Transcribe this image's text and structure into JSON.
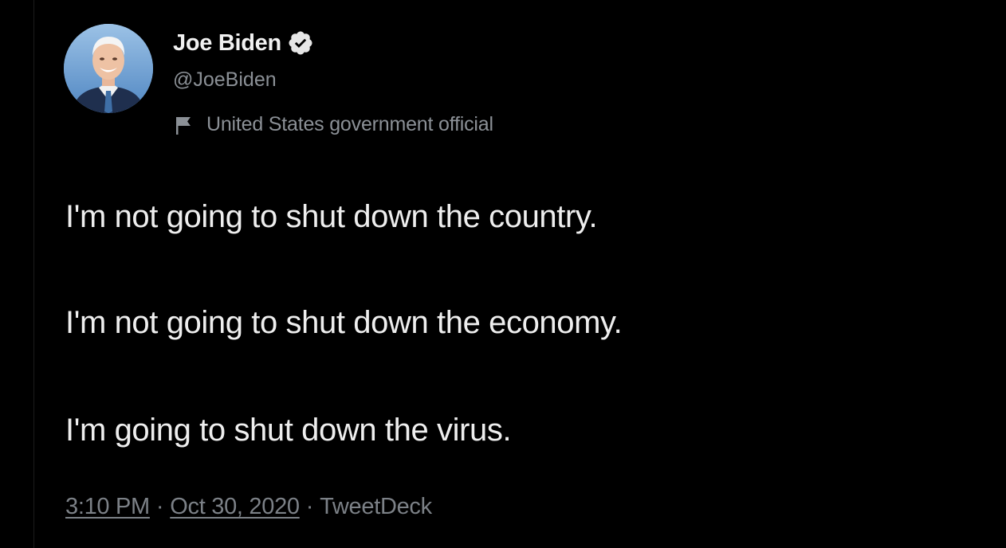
{
  "author": {
    "display_name": "Joe Biden",
    "handle": "@JoeBiden",
    "verified": true,
    "label": "United States government official"
  },
  "tweet": {
    "lines": [
      "I'm not going to shut down the country.",
      "I'm not going to shut down the economy.",
      "I'm going to shut down the virus."
    ]
  },
  "meta": {
    "time": "3:10 PM",
    "separator": "·",
    "date": "Oct 30, 2020",
    "source": "TweetDeck"
  },
  "colors": {
    "background": "#000000",
    "text": "#eeeeee",
    "secondary_text": "#8b9096",
    "verified_badge": "#e6e6e6"
  },
  "icons": {
    "verified": "verified-badge-icon",
    "label": "flag-icon"
  }
}
